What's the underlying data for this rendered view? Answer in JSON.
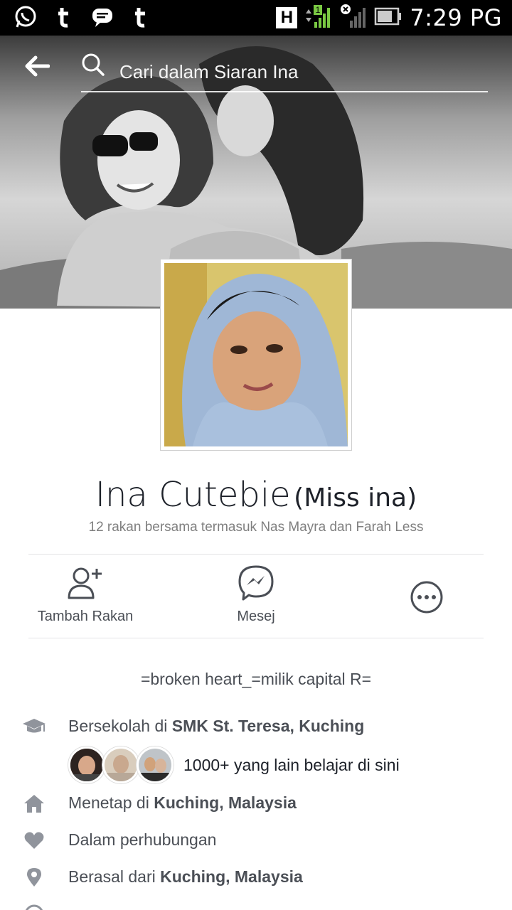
{
  "status_bar": {
    "left_icons": [
      "whatsapp-icon",
      "tumblr-icon",
      "messaging-icon",
      "tumblr-icon"
    ],
    "h_badge": "H",
    "signal_badge": "1",
    "time": "7:29 PG"
  },
  "header": {
    "search_placeholder": "Cari dalam Siaran Ina"
  },
  "profile": {
    "name": "Ina Cutebie",
    "alt_name": "(Miss ina)",
    "mutual_friends": "12 rakan bersama termasuk Nas Mayra dan Farah Less"
  },
  "actions": {
    "add_friend": "Tambah Rakan",
    "message": "Mesej"
  },
  "bio": "=broken heart_=milik capital R=",
  "info": {
    "school_prefix": "Bersekolah di ",
    "school_name": "SMK St. Teresa, Kuching",
    "classmates": "1000+ yang lain belajar di sini",
    "lives_prefix": "Menetap di ",
    "lives_place": "Kuching, Malaysia",
    "relationship": "Dalam perhubungan",
    "from_prefix": "Berasal dari ",
    "from_place": "Kuching, Malaysia"
  },
  "colors": {
    "icon_gray": "#90949c",
    "text_dark": "#1d2129",
    "text_gray": "#4b4f56"
  }
}
